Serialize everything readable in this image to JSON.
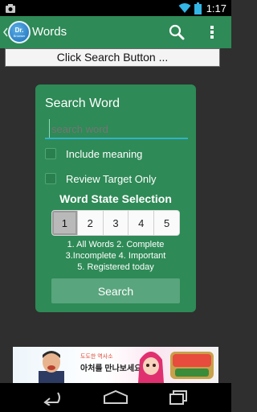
{
  "status_bar": {
    "time": "1:17"
  },
  "action_bar": {
    "title": "Words",
    "logo_text": "Dr.",
    "logo_subtext": "Browser"
  },
  "search_bar": {
    "label": "Click Search Button ..."
  },
  "panel": {
    "title": "Search Word",
    "search_placeholder": "search word",
    "include_meaning_label": "Include meaning",
    "review_target_label": "Review Target Only",
    "state_title": "Word State Selection",
    "state_options": [
      "1",
      "2",
      "3",
      "4",
      "5"
    ],
    "selected_state": "1",
    "legend_line1": "1. All Words 2. Complete",
    "legend_line2": "3.Incomplete 4. Important",
    "legend_line3": "5. Registered today",
    "search_button_label": "Search"
  },
  "ad": {
    "text1": "도도한 역사소",
    "text2": "아처를 만나보세요!"
  },
  "colors": {
    "accent": "#2e8a56",
    "background": "#2f2f2f",
    "search_button": "#59a57d",
    "input_underline": "#2fb3c9"
  },
  "icons": [
    "camera-icon",
    "wifi-icon",
    "battery-icon",
    "search-icon",
    "overflow-menu-icon",
    "back-icon",
    "home-icon",
    "recent-apps-icon"
  ]
}
